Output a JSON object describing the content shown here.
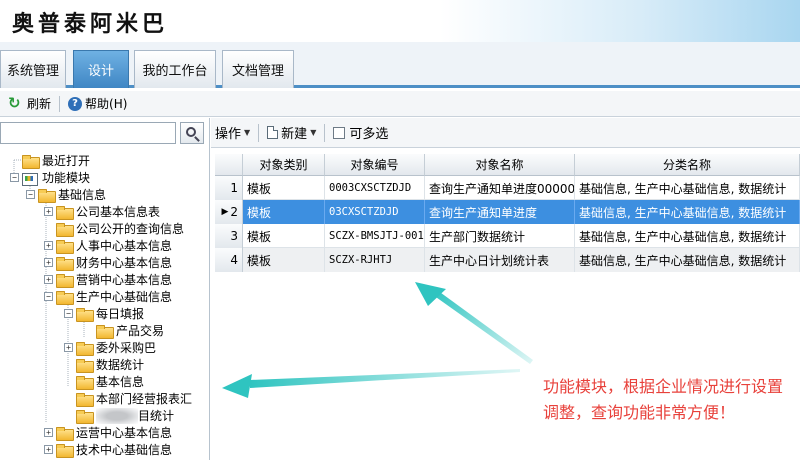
{
  "header": {
    "app_title": "奥普泰阿米巴"
  },
  "tabs": [
    {
      "label": "系统管理",
      "active": false
    },
    {
      "label": "设计",
      "active": true
    },
    {
      "label": "我的工作台",
      "active": false
    },
    {
      "label": "文档管理",
      "active": false
    }
  ],
  "toolbar": {
    "refresh_label": "刷新",
    "help_label": "帮助(H)"
  },
  "search": {
    "value": ""
  },
  "tree": {
    "recent": "最近打开",
    "modules": "功能模块",
    "basic_info": "基础信息",
    "company_basic": "公司基本信息表",
    "company_public": "公司公开的查询信息",
    "hr_basic": "人事中心基本信息",
    "finance_basic": "财务中心基本信息",
    "marketing_basic": "营销中心基本信息",
    "production_basic": "生产中心基础信息",
    "daily_fill": "每日填报",
    "product_trade": "产品交易",
    "outsource": "委外采购巴",
    "data_stats": "数据统计",
    "basic_info2": "基本信息",
    "dept_report": "本部门经营报表汇",
    "blurred_stats": "目统计",
    "ops_basic": "运营中心基本信息",
    "tech_basic": "技术中心基础信息"
  },
  "right_toolbar": {
    "action_label": "操作",
    "new_label": "新建",
    "multi_select_label": "可多选"
  },
  "grid": {
    "columns": [
      "对象类别",
      "对象编号",
      "对象名称",
      "分类名称"
    ],
    "rows": [
      {
        "num": "1",
        "type": "模板",
        "code": "0003CXSCTZDJD",
        "name": "查询生产通知单进度00000",
        "category": "基础信息, 生产中心基础信息, 数据统计",
        "selected": false
      },
      {
        "num": "2",
        "type": "模板",
        "code": "03CXSCTZDJD",
        "name": "查询生产通知单进度",
        "category": "基础信息, 生产中心基础信息, 数据统计",
        "selected": true
      },
      {
        "num": "3",
        "type": "模板",
        "code": "SCZX-BMSJTJ-001",
        "name": "生产部门数据统计",
        "category": "基础信息, 生产中心基础信息, 数据统计",
        "selected": false
      },
      {
        "num": "4",
        "type": "模板",
        "code": "SCZX-RJHTJ",
        "name": "生产中心日计划统计表",
        "category": "基础信息, 生产中心基础信息, 数据统计",
        "selected": false
      }
    ]
  },
  "annotation": {
    "text": "功能模块，根据企业情况进行设置调整，查询功能非常方便！"
  },
  "colors": {
    "tab_active": "#3f86c4",
    "row_selected": "#3d8fe0",
    "annotation": "#e8413b",
    "arrow": "#2fc4c0"
  }
}
